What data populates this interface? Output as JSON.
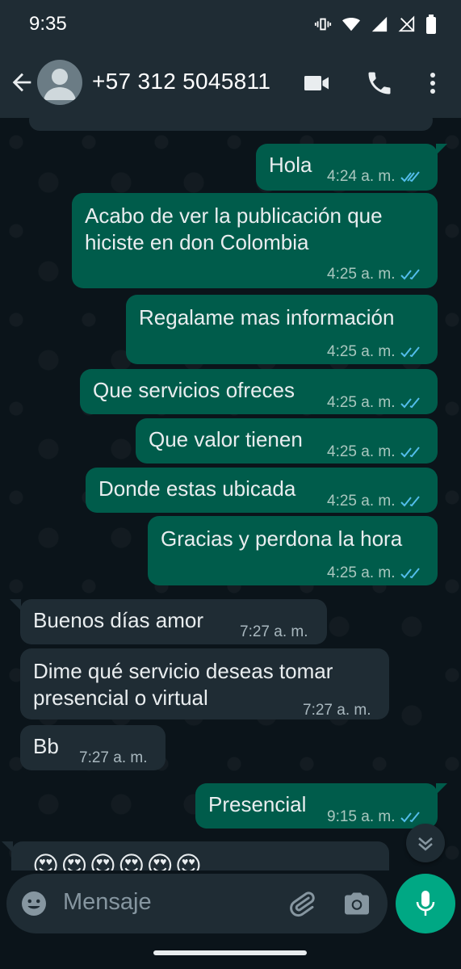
{
  "status_bar": {
    "time": "9:35"
  },
  "header": {
    "contact": "+57 312 5045811"
  },
  "messages": [
    {
      "dir": "out",
      "text": "Hola",
      "time": "4:24 a. m."
    },
    {
      "dir": "out",
      "text": "Acabo de ver la publicación que hiciste en don Colombia",
      "line1": "Acabo de ver la publicación que",
      "line2": "hiciste en don Colombia",
      "time": "4:25 a. m."
    },
    {
      "dir": "out",
      "text": "Regalame mas información",
      "time": "4:25 a. m."
    },
    {
      "dir": "out",
      "text": "Que servicios ofreces",
      "time": "4:25 a. m."
    },
    {
      "dir": "out",
      "text": "Que valor tienen",
      "time": "4:25 a. m."
    },
    {
      "dir": "out",
      "text": "Donde estas ubicada",
      "time": "4:25 a. m."
    },
    {
      "dir": "out",
      "text": "Gracias y perdona la hora",
      "time": "4:25 a. m."
    },
    {
      "dir": "in",
      "text": "Buenos días amor",
      "time": "7:27 a. m."
    },
    {
      "dir": "in",
      "text": "Dime qué servicio deseas tomar presencial o virtual",
      "line1": "Dime qué servicio deseas tomar",
      "line2": "presencial o virtual",
      "time": "7:27 a. m."
    },
    {
      "dir": "in",
      "text": "Bb",
      "time": "7:27 a. m."
    },
    {
      "dir": "out",
      "text": "Presencial",
      "time": "9:15 a. m."
    },
    {
      "dir": "in",
      "text": "😍😍😍😍😍😍"
    }
  ],
  "composer": {
    "placeholder": "Mensaje"
  },
  "colors": {
    "outgoing": "#005c4b",
    "incoming": "#1f2c34",
    "accent": "#00a884",
    "read_ticks": "#53bdeb"
  },
  "icons": [
    "back-arrow-icon",
    "avatar-icon",
    "video-call-icon",
    "phone-icon",
    "more-vert-icon",
    "emoji-icon",
    "attach-icon",
    "camera-icon",
    "mic-icon",
    "scroll-down-icon"
  ]
}
